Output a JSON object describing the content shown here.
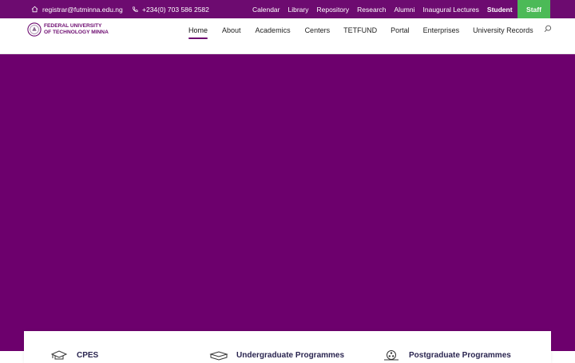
{
  "topbar": {
    "email": "registrar@futminna.edu.ng",
    "phone": "+234(0) 703 586 2582",
    "links": [
      "Calendar",
      "Library",
      "Repository",
      "Research",
      "Alumni",
      "Inaugural Lectures"
    ],
    "student": "Student",
    "staff": "Staff"
  },
  "logo": {
    "line1": "FEDERAL UNIVERSITY",
    "line2": "OF TECHNOLOGY MINNA"
  },
  "nav": {
    "items": [
      "Home",
      "About",
      "Academics",
      "Centers",
      "TETFUND",
      "Portal",
      "Enterprises",
      "University Records"
    ]
  },
  "programmes": {
    "items": [
      "CPES",
      "Undergraduate Programmes",
      "Postgraduate Programmes"
    ]
  },
  "colors": {
    "brand_purple": "#6d0b70",
    "hero_purple": "#6d006d",
    "staff_green": "#4cba57"
  },
  "icons": [
    "home-icon",
    "phone-icon",
    "search-icon",
    "university-seal-icon",
    "graduation-cap-icon",
    "book-icon",
    "film-reel-icon"
  ]
}
